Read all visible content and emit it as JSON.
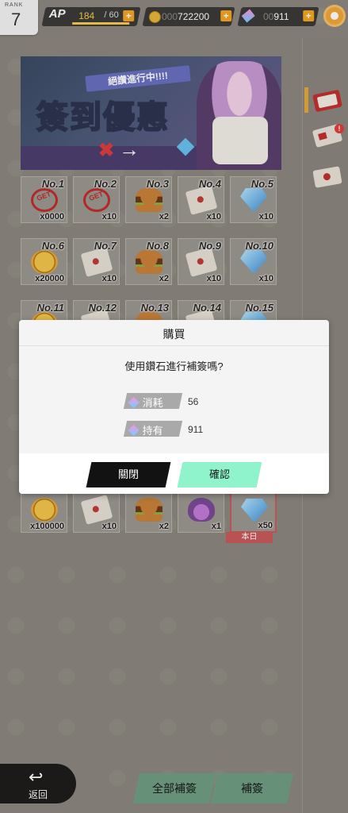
{
  "rank": {
    "label": "RANK",
    "value": "7"
  },
  "ap": {
    "label": "AP",
    "current": "184",
    "max": "/ 60",
    "fill_fraction": 1.0
  },
  "currency": {
    "coin_dim": "000",
    "coin_value": "722200",
    "gem_dim": "00",
    "gem_value": "911",
    "plus": "+"
  },
  "banner": {
    "ribbon": "絕讚進行中!!!!",
    "title": "簽到優惠",
    "cross": "✖",
    "arrow": "→"
  },
  "right_panel": {
    "badge": "!"
  },
  "grid": {
    "cells": [
      {
        "no": "No.1",
        "qty": "x0000",
        "art": "stamp",
        "stamp": "GET"
      },
      {
        "no": "No.2",
        "qty": "x10",
        "art": "stamp",
        "stamp": "GET"
      },
      {
        "no": "No.3",
        "qty": "x2",
        "art": "burger"
      },
      {
        "no": "No.4",
        "qty": "x10",
        "art": "ticket"
      },
      {
        "no": "No.5",
        "qty": "x10",
        "art": "gem"
      },
      {
        "no": "No.6",
        "qty": "x20000",
        "art": "coin"
      },
      {
        "no": "No.7",
        "qty": "x10",
        "art": "ticket"
      },
      {
        "no": "No.8",
        "qty": "x2",
        "art": "burger"
      },
      {
        "no": "No.9",
        "qty": "x10",
        "art": "ticket"
      },
      {
        "no": "No.10",
        "qty": "x10",
        "art": "gem"
      },
      {
        "no": "No.11",
        "qty": "",
        "art": "coin"
      },
      {
        "no": "No.12",
        "qty": "",
        "art": "ticket"
      },
      {
        "no": "No.13",
        "qty": "",
        "art": "burger"
      },
      {
        "no": "No.14",
        "qty": "",
        "art": "ticket"
      },
      {
        "no": "No.15",
        "qty": "",
        "art": "gem"
      },
      {
        "no": "",
        "qty": "x100000",
        "art": "coin"
      },
      {
        "no": "",
        "qty": "x10",
        "art": "ticket"
      },
      {
        "no": "",
        "qty": "x2",
        "art": "burger"
      },
      {
        "no": "",
        "qty": "x1",
        "art": "potion"
      },
      {
        "no": "",
        "qty": "x50",
        "art": "gem"
      }
    ],
    "today_label": "本日"
  },
  "bottom": {
    "back_icon": "↩",
    "back_label": "返回",
    "btn_all": "全部補簽",
    "btn_one": "補簽"
  },
  "dialog": {
    "title": "購買",
    "message": "使用鑽石進行補簽嗎?",
    "cost_label": "消耗",
    "cost_value": "56",
    "own_label": "持有",
    "own_value": "911",
    "close_label": "關閉",
    "confirm_label": "確認"
  }
}
